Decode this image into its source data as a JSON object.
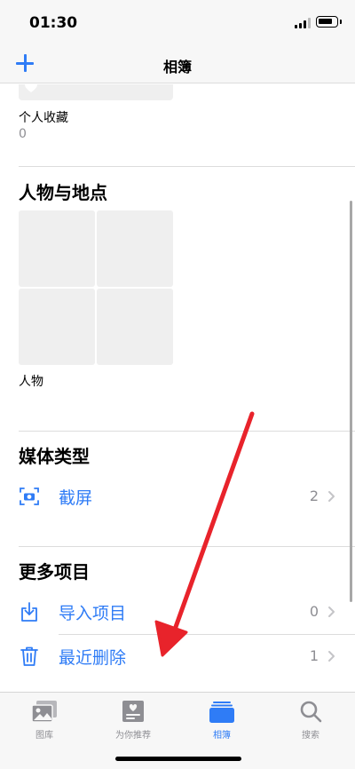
{
  "status_bar": {
    "time": "01:30"
  },
  "nav": {
    "title": "相簿",
    "add_icon": "plus-icon"
  },
  "favorites": {
    "label": "个人收藏",
    "count": "0"
  },
  "people_places": {
    "title": "人物与地点",
    "people_label": "人物"
  },
  "media_types": {
    "title": "媒体类型",
    "items": [
      {
        "label": "截屏",
        "count": "2",
        "icon": "screenshot-icon"
      }
    ]
  },
  "more_items": {
    "title": "更多项目",
    "items": [
      {
        "label": "导入项目",
        "count": "0",
        "icon": "import-icon"
      },
      {
        "label": "最近删除",
        "count": "1",
        "icon": "trash-icon"
      }
    ]
  },
  "tab_bar": {
    "tabs": [
      {
        "label": "图库",
        "icon": "photo-library-icon",
        "active": false
      },
      {
        "label": "为你推荐",
        "icon": "for-you-icon",
        "active": false
      },
      {
        "label": "相簿",
        "icon": "albums-icon",
        "active": true
      },
      {
        "label": "搜索",
        "icon": "search-icon",
        "active": false
      }
    ]
  },
  "colors": {
    "accent": "#2f7cf6",
    "annotation_arrow": "#e8232b",
    "secondary_text": "#8e8e93"
  }
}
